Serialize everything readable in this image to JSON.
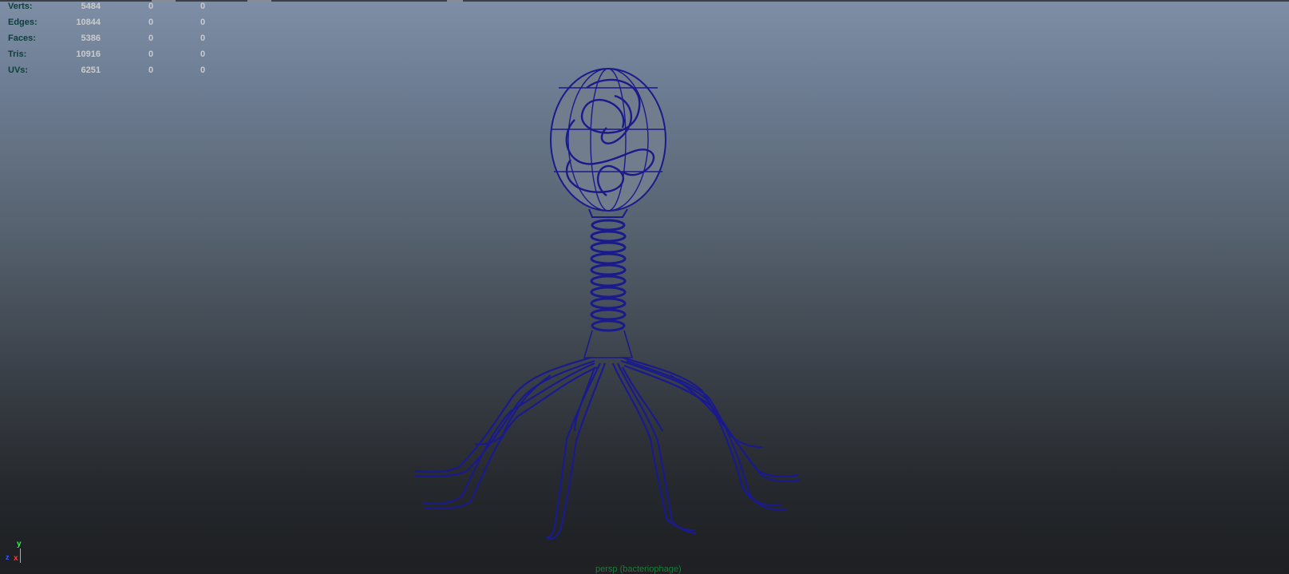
{
  "hud": {
    "rows": [
      {
        "label": "Verts:",
        "v1": "5484",
        "v2": "0",
        "v3": "0"
      },
      {
        "label": "Edges:",
        "v1": "10844",
        "v2": "0",
        "v3": "0"
      },
      {
        "label": "Faces:",
        "v1": "5386",
        "v2": "0",
        "v3": "0"
      },
      {
        "label": "Tris:",
        "v1": "10916",
        "v2": "0",
        "v3": "0"
      },
      {
        "label": "UVs:",
        "v1": "6251",
        "v2": "0",
        "v3": "0"
      }
    ]
  },
  "axis": {
    "y": "y",
    "x": "x",
    "z": "z"
  },
  "camera_label": "persp (bacteriophage)",
  "colors": {
    "wireframe": "#1a1a8c",
    "hud_label": "#0e3e3a",
    "hud_value": "#c9ccd0",
    "axis_x": "#ff3a3a",
    "axis_y": "#2dff4a"
  }
}
